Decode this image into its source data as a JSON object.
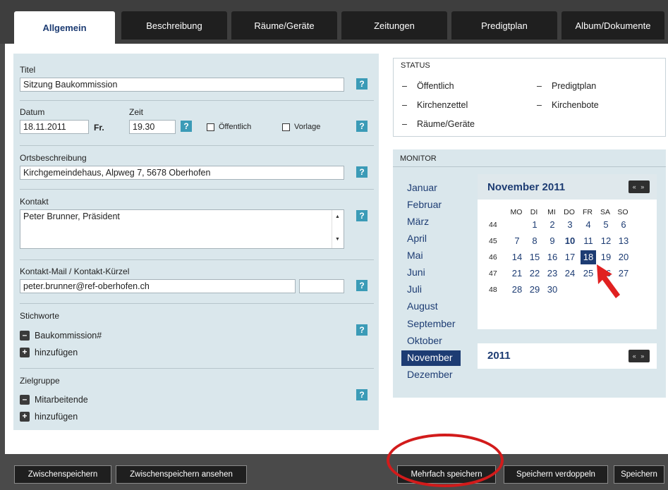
{
  "tabs": [
    {
      "label": "Allgemein"
    },
    {
      "label": "Beschreibung"
    },
    {
      "label": "Räume/Geräte"
    },
    {
      "label": "Zeitungen"
    },
    {
      "label": "Predigtplan"
    },
    {
      "label": "Album/Dokumente"
    }
  ],
  "form": {
    "titel_label": "Titel",
    "titel_value": "Sitzung Baukommission",
    "datum_label": "Datum",
    "datum_value": "18.11.2011",
    "weekday": "Fr.",
    "zeit_label": "Zeit",
    "zeit_value": "19.30",
    "oeffentlich_label": "Öffentlich",
    "vorlage_label": "Vorlage",
    "ort_label": "Ortsbeschreibung",
    "ort_value": "Kirchgemeindehaus, Alpweg 7, 5678 Oberhofen",
    "kontakt_label": "Kontakt",
    "kontakt_value": "Peter Brunner, Präsident",
    "mail_label": "Kontakt-Mail / Kontakt-Kürzel",
    "mail_value": "peter.brunner@ref-oberhofen.ch",
    "kuerzel_value": "",
    "stichworte_label": "Stichworte",
    "stichwort_item": "Baukommission#",
    "add_label": "hinzufügen",
    "zielgruppe_label": "Zielgruppe",
    "zielgruppe_item": "Mitarbeitende",
    "help_glyph": "?"
  },
  "status": {
    "header": "STATUS",
    "dash": "–",
    "left": [
      "Öffentlich",
      "Kirchenzettel",
      "Räume/Geräte"
    ],
    "right": [
      "Predigtplan",
      "Kirchenbote"
    ]
  },
  "monitor": {
    "header": "MONITOR",
    "months": [
      "Januar",
      "Februar",
      "März",
      "April",
      "Mai",
      "Juni",
      "Juli",
      "August",
      "September",
      "Oktober",
      "November",
      "Dezember"
    ],
    "selected_month": "November",
    "calendar_title": "November 2011",
    "weekdays": [
      "MO",
      "DI",
      "MI",
      "DO",
      "FR",
      "SA",
      "SO"
    ],
    "weeks": [
      {
        "wk": "44",
        "days": [
          "",
          "1",
          "2",
          "3",
          "4",
          "5",
          "6"
        ]
      },
      {
        "wk": "45",
        "days": [
          "7",
          "8",
          "9",
          "10",
          "11",
          "12",
          "13"
        ]
      },
      {
        "wk": "46",
        "days": [
          "14",
          "15",
          "16",
          "17",
          "18",
          "19",
          "20"
        ]
      },
      {
        "wk": "47",
        "days": [
          "21",
          "22",
          "23",
          "24",
          "25",
          "26",
          "27"
        ]
      },
      {
        "wk": "48",
        "days": [
          "28",
          "29",
          "30",
          "",
          "",
          "",
          ""
        ]
      }
    ],
    "selected_day": "18",
    "bold_day": "10",
    "year": "2011",
    "nav_glyph": "«  »"
  },
  "buttons": {
    "zwischenspeichern": "Zwischenspeichern",
    "zwischenspeichern_ansehen": "Zwischenspeichern ansehen",
    "mehrfach": "Mehrfach speichern",
    "verdoppeln": "Speichern verdoppeln",
    "speichern": "Speichern"
  },
  "colors": {
    "accent": "#1d3c73",
    "panel": "#dae7ec",
    "help": "#3b9bb7",
    "highlight_ring": "#d21b1b",
    "arrow": "#e02020"
  }
}
